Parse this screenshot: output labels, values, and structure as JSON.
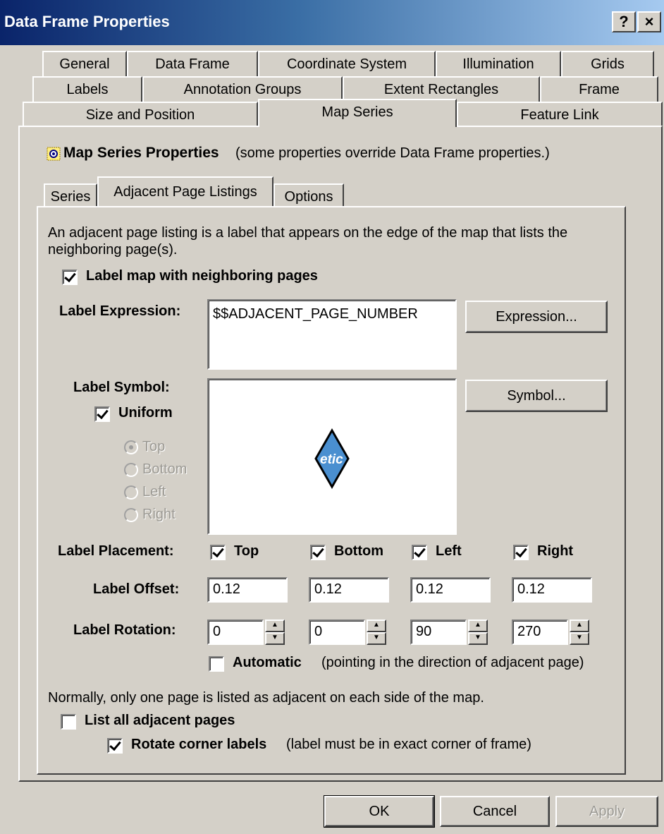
{
  "window": {
    "title": "Data Frame Properties",
    "help_label": "?",
    "close_label": "×"
  },
  "tabs": {
    "row1": [
      "General",
      "Data Frame",
      "Coordinate System",
      "Illumination",
      "Grids"
    ],
    "row2": [
      "Labels",
      "Annotation Groups",
      "Extent Rectangles",
      "Frame"
    ],
    "row3": [
      "Size and Position",
      "Map Series",
      "Feature Link"
    ]
  },
  "map_series": {
    "heading": "Map Series Properties",
    "heading_note": "(some properties override Data Frame properties.)",
    "subtabs": [
      "Series",
      "Adjacent Page Listings",
      "Options"
    ]
  },
  "adjacent": {
    "description": "An adjacent page listing is a label that appears on the edge of the map that lists the neighboring page(s).",
    "label_map_checkbox": "Label map with neighboring pages",
    "label_expression_label": "Label Expression:",
    "label_expression_value": "$$ADJACENT_PAGE_NUMBER",
    "expression_button": "Expression...",
    "label_symbol_label": "Label Symbol:",
    "symbol_button": "Symbol...",
    "uniform_label": "Uniform",
    "radio_top": "Top",
    "radio_bottom": "Bottom",
    "radio_left": "Left",
    "radio_right": "Right",
    "symbol_preview_text": "etic",
    "label_placement_label": "Label Placement:",
    "placement_top": "Top",
    "placement_bottom": "Bottom",
    "placement_left": "Left",
    "placement_right": "Right",
    "label_offset_label": "Label Offset:",
    "offset_top": "0.12",
    "offset_bottom": "0.12",
    "offset_left": "0.12",
    "offset_right": "0.12",
    "label_rotation_label": "Label Rotation:",
    "rotation_top": "0",
    "rotation_bottom": "0",
    "rotation_left": "90",
    "rotation_right": "270",
    "automatic_label": "Automatic",
    "automatic_note": "(pointing in the direction of adjacent page)",
    "normally_text": "Normally, only one page is listed as adjacent on each side of the map.",
    "list_all_label": "List all adjacent pages",
    "rotate_corner_label": "Rotate corner labels",
    "rotate_corner_note": "(label must be in exact corner of frame)"
  },
  "footer": {
    "ok": "OK",
    "cancel": "Cancel",
    "apply": "Apply"
  },
  "colors": {
    "face": "#d4d0c8",
    "title_start": "#0a246a",
    "title_end": "#a6caf0",
    "symbol_fill": "#4a8fd0"
  }
}
